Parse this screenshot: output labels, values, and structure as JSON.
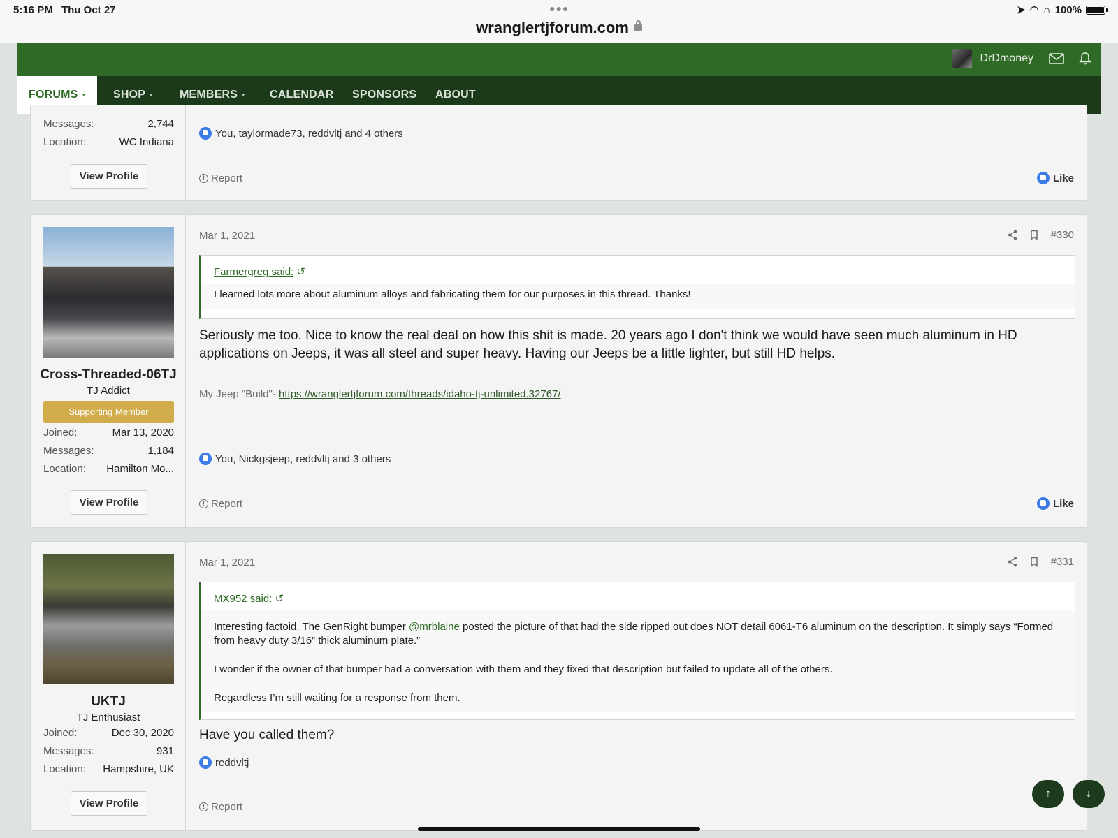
{
  "status_bar": {
    "time": "5:16 PM",
    "date": "Thu Oct 27",
    "battery": "100%",
    "url": "wranglertjforum.com"
  },
  "header": {
    "username": "DrDmoney"
  },
  "nav": {
    "forums": "FORUMS",
    "shop": "SHOP",
    "members": "MEMBERS",
    "calendar": "CALENDAR",
    "sponsors": "SPONSORS",
    "about": "ABOUT"
  },
  "post_top": {
    "messages_label": "Messages:",
    "messages": "2,744",
    "location_label": "Location:",
    "location": "WC Indiana",
    "view_profile": "View Profile",
    "likes": "You, taylormade73, reddvltj and 4 others",
    "report": "Report",
    "like": "Like"
  },
  "post_330": {
    "username": "Cross-Threaded-06TJ",
    "user_title": "TJ Addict",
    "badge": "Supporting Member",
    "joined_label": "Joined:",
    "joined": "Mar 13, 2020",
    "messages_label": "Messages:",
    "messages": "1,184",
    "location_label": "Location:",
    "location": "Hamilton Mo...",
    "view_profile": "View Profile",
    "date": "Mar 1, 2021",
    "number": "#330",
    "quote_author": "Farmergreg said:",
    "quote_text": "I learned lots more about aluminum alloys and fabricating them for our purposes in this thread. Thanks!",
    "body": "Seriously me too. Nice to know the real deal on how this shit is made. 20 years ago I don't think we would have seen much aluminum in HD applications on Jeeps, it was all steel and super heavy. Having our Jeeps be a little lighter, but still HD helps.",
    "sig_label": "My Jeep \"Build\"- ",
    "sig_link": "https://wranglertjforum.com/threads/idaho-tj-unlimited.32767/",
    "likes": "You, Nickgsjeep, reddvltj and 3 others",
    "report": "Report",
    "like": "Like"
  },
  "post_331": {
    "username": "UKTJ",
    "user_title": "TJ Enthusiast",
    "joined_label": "Joined:",
    "joined": "Dec 30, 2020",
    "messages_label": "Messages:",
    "messages": "931",
    "location_label": "Location:",
    "location": "Hampshire, UK",
    "view_profile": "View Profile",
    "date": "Mar 1, 2021",
    "number": "#331",
    "quote_author": "MX952 said:",
    "quote_p1_a": "Interesting factoid. The GenRight bumper ",
    "quote_p1_mention": "@mrblaine",
    "quote_p1_b": " posted the picture of that had the side ripped out does NOT detail 6061-T6 aluminum on the description. It simply says “Formed from heavy duty 3/16” thick aluminum plate.”",
    "quote_p2": "I wonder if the owner of that bumper had a conversation with them and they fixed that description but failed to update all of the others.",
    "quote_p3": "Regardless I’m still waiting for a response from them.",
    "body": "Have you called them?",
    "likes": "reddvltj",
    "report": "Report"
  },
  "icons": {
    "scroll_up": "↑",
    "scroll_down": "↓"
  }
}
